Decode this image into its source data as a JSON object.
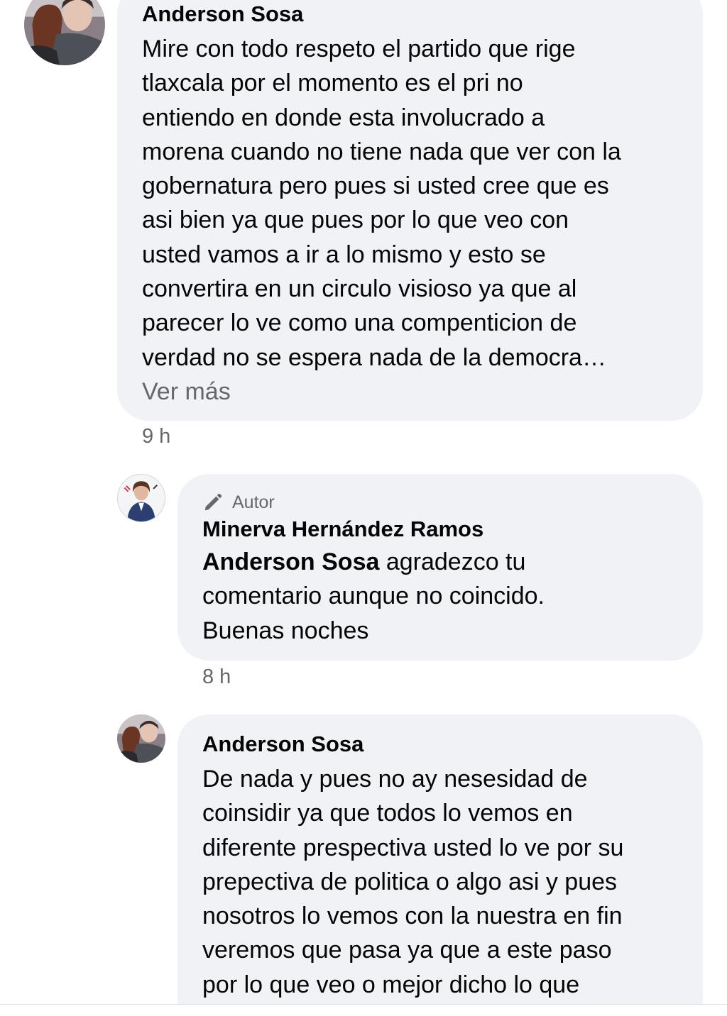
{
  "comments": [
    {
      "author": "Anderson Sosa",
      "lines": [
        "Mire con todo respeto el partido que rige",
        "tlaxcala por el momento es el pri no",
        "entiendo en donde esta involucrado a",
        "morena cuando no tiene nada que ver con la",
        "gobernatura pero pues si usted cree que es",
        "asi bien ya que pues por lo que veo con",
        "usted vamos a ir a lo mismo y esto se",
        "convertira en un circulo visioso ya que al",
        "parecer lo ve como una compenticion de",
        "verdad no se espera nada de la democra…"
      ],
      "see_more": "Ver más",
      "time": "9 h"
    },
    {
      "badge": "Autor",
      "author": "Minerva Hernández Ramos",
      "mention": "Anderson Sosa",
      "first_line_rest": " agradezco tu",
      "lines": [
        "comentario aunque no coincido.",
        "Buenas noches"
      ],
      "time": "8 h"
    },
    {
      "author": "Anderson Sosa",
      "lines": [
        "De nada y pues no ay nesesidad de",
        "coinsidir ya que todos lo vemos en",
        "diferente prespectiva usted lo ve por su",
        "prepectiva de politica o algo asi y pues",
        "nosotros lo vemos con la nuestra en fin",
        "veremos que pasa ya que a este paso",
        "por lo que veo o mejor dicho lo que"
      ]
    }
  ],
  "icons": {
    "badge_icon": "pencil-icon"
  },
  "colors": {
    "bubble": "#f0f2f5",
    "secondary_text": "#65676b",
    "primary_text": "#050505"
  }
}
